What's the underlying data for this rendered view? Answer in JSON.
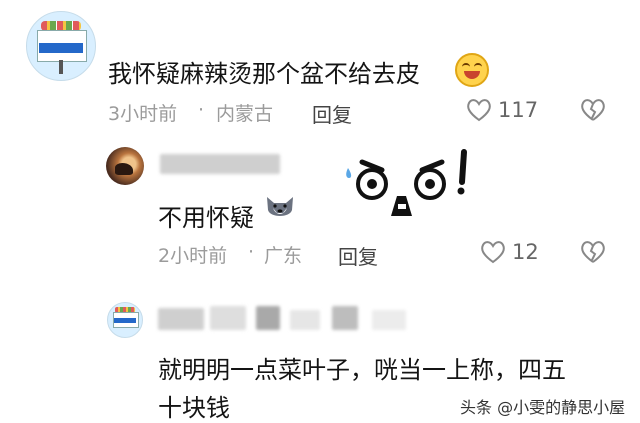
{
  "comments": [
    {
      "text": "我怀疑麻辣烫那个盆不给去皮",
      "time": "3小时前",
      "separator": "·",
      "location": "内蒙古",
      "reply_label": "回复",
      "likes": "117"
    },
    {
      "text": "不用怀疑",
      "time": "2小时前",
      "separator": "·",
      "location": "广东",
      "reply_label": "回复",
      "likes": "12"
    },
    {
      "text_line1": "就明明一点菜叶子，咣当一上称，四五",
      "text_line2": "十块钱"
    }
  ],
  "watermark": "头条 @小雯的静思小屋",
  "icons": {
    "like": "heart-outline-icon",
    "dislike": "broken-heart-icon",
    "emoji_laugh": "grinning-emoji-icon",
    "emoji_husky": "husky-emoji-icon",
    "sticker": "shocked-face-sticker"
  },
  "colors": {
    "meta": "#9b9b9b",
    "text": "#141414"
  }
}
